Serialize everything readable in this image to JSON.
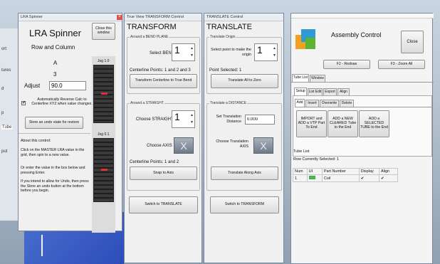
{
  "background": {
    "left_tabs": [
      "ort",
      "tures",
      "d",
      "p",
      "Tube",
      "put"
    ]
  },
  "lra": {
    "title": "LRA Spinner",
    "heading": "LRA Spinner",
    "subheading": "Row and Column",
    "row_value": "A",
    "col_value": "3",
    "adjust_label": "Adjust",
    "adjust_value": "90.0",
    "auto_reverse": "Automatically Reverse Calc to Centerline XYZ when value changes.",
    "store_btn": "Store an undo state for restore",
    "close_btn": "Close this window",
    "jog1": "Jog 1.0",
    "jog2": "Jog 0.1",
    "about_title": "About this control:",
    "about_p1": "Click on the MASTER LRA value in the grid, then spin to a new value.",
    "about_p2": "Or enter the value in the box below and pressing Enter.",
    "about_p3": "If you intend to allow for Undo, then press the Store an undo button at the bottom before you begin."
  },
  "transform": {
    "title": "True View TRANSFORM Control",
    "heading": "TRANSFORM",
    "group1": "Around a BEND PLANE",
    "select_bend": "Select BEND",
    "bend_value": "1",
    "centerline_points1": "Centerline Points: 1 and 2 and 3",
    "transform_btn": "Transform Centerline to True Bend",
    "group2": "Around a STRAIGHT",
    "choose_straight": "Choose STRAIGHT",
    "straight_value": "1",
    "choose_axis": "Choose AXIS",
    "axis_value": "X",
    "centerline_points2": "Centerline Points: 1 and 2",
    "snap_btn": "Snap to Axis",
    "switch_btn": "Switch to TRANSLATE"
  },
  "translate": {
    "title": "TRANSLATE Control",
    "heading": "TRANSLATE",
    "group1": "Translate Origin",
    "select_point": "Select point to make the origin",
    "point_value": "1",
    "point_selected": "Point Selected: 1",
    "translate_zero_btn": "Translate All to Zero",
    "group2": "Translate a DISTANCE",
    "set_distance": "Set Translation Distance",
    "distance_value": "0.000",
    "choose_axis": "Choose Translation AXIS",
    "axis_value": "X",
    "along_axis_btn": "Translate Along Axis",
    "switch_btn": "Switch to TRANSFORM"
  },
  "assembly": {
    "title": "Assembly Control",
    "close_btn": "Close",
    "redraw_btn": "F2 - Redraw",
    "zoom_btn": "F3 - Zoom All",
    "tabs": [
      "Tube List",
      "Window"
    ],
    "subtabs": [
      "Setup",
      "List Edit",
      "Export",
      "Align"
    ],
    "addtabs": [
      "Add",
      "Insert",
      "Overwrite",
      "Delete"
    ],
    "import_btn": "IMPORT and ADD a VTP Part To End",
    "add_new_btn": "ADD a NEW CLEARED Tube to the End",
    "add_selected_btn": "ADD a SELECTED TUBE to the End",
    "tube_list_label": "Tube List",
    "row_selected": "Row Currently Selected:  1",
    "columns": [
      "Num",
      "UI",
      "Part Number",
      "Display",
      "Align"
    ],
    "rows": [
      {
        "num": "1",
        "part": "Coil",
        "display": "✔",
        "align": "✔"
      }
    ],
    "accent": "#2e9ad6"
  }
}
